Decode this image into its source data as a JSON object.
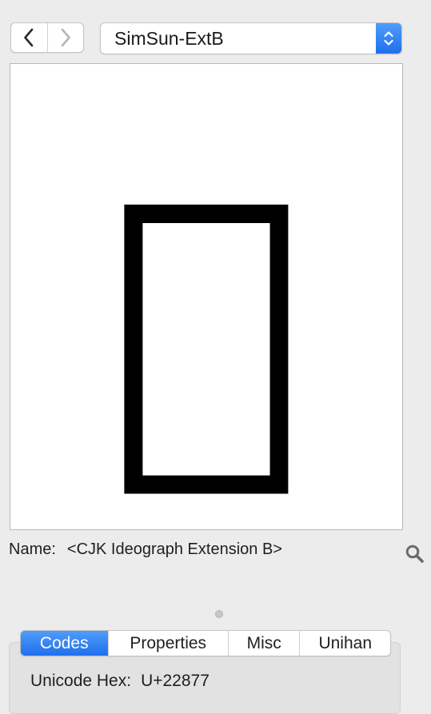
{
  "toolbar": {
    "font_name": "SimSun-ExtB"
  },
  "glyph": {
    "character": "𢡷"
  },
  "name_row": {
    "label": "Name:",
    "value": "<CJK Ideograph Extension B>"
  },
  "tabs": [
    {
      "label": "Codes",
      "active": true
    },
    {
      "label": "Properties",
      "active": false
    },
    {
      "label": "Misc",
      "active": false
    },
    {
      "label": "Unihan",
      "active": false
    }
  ],
  "codes": {
    "unicode_hex_label": "Unicode Hex:",
    "unicode_hex_value": "U+22877"
  },
  "colors": {
    "accent": "#1f6fec",
    "background": "#ececec"
  }
}
